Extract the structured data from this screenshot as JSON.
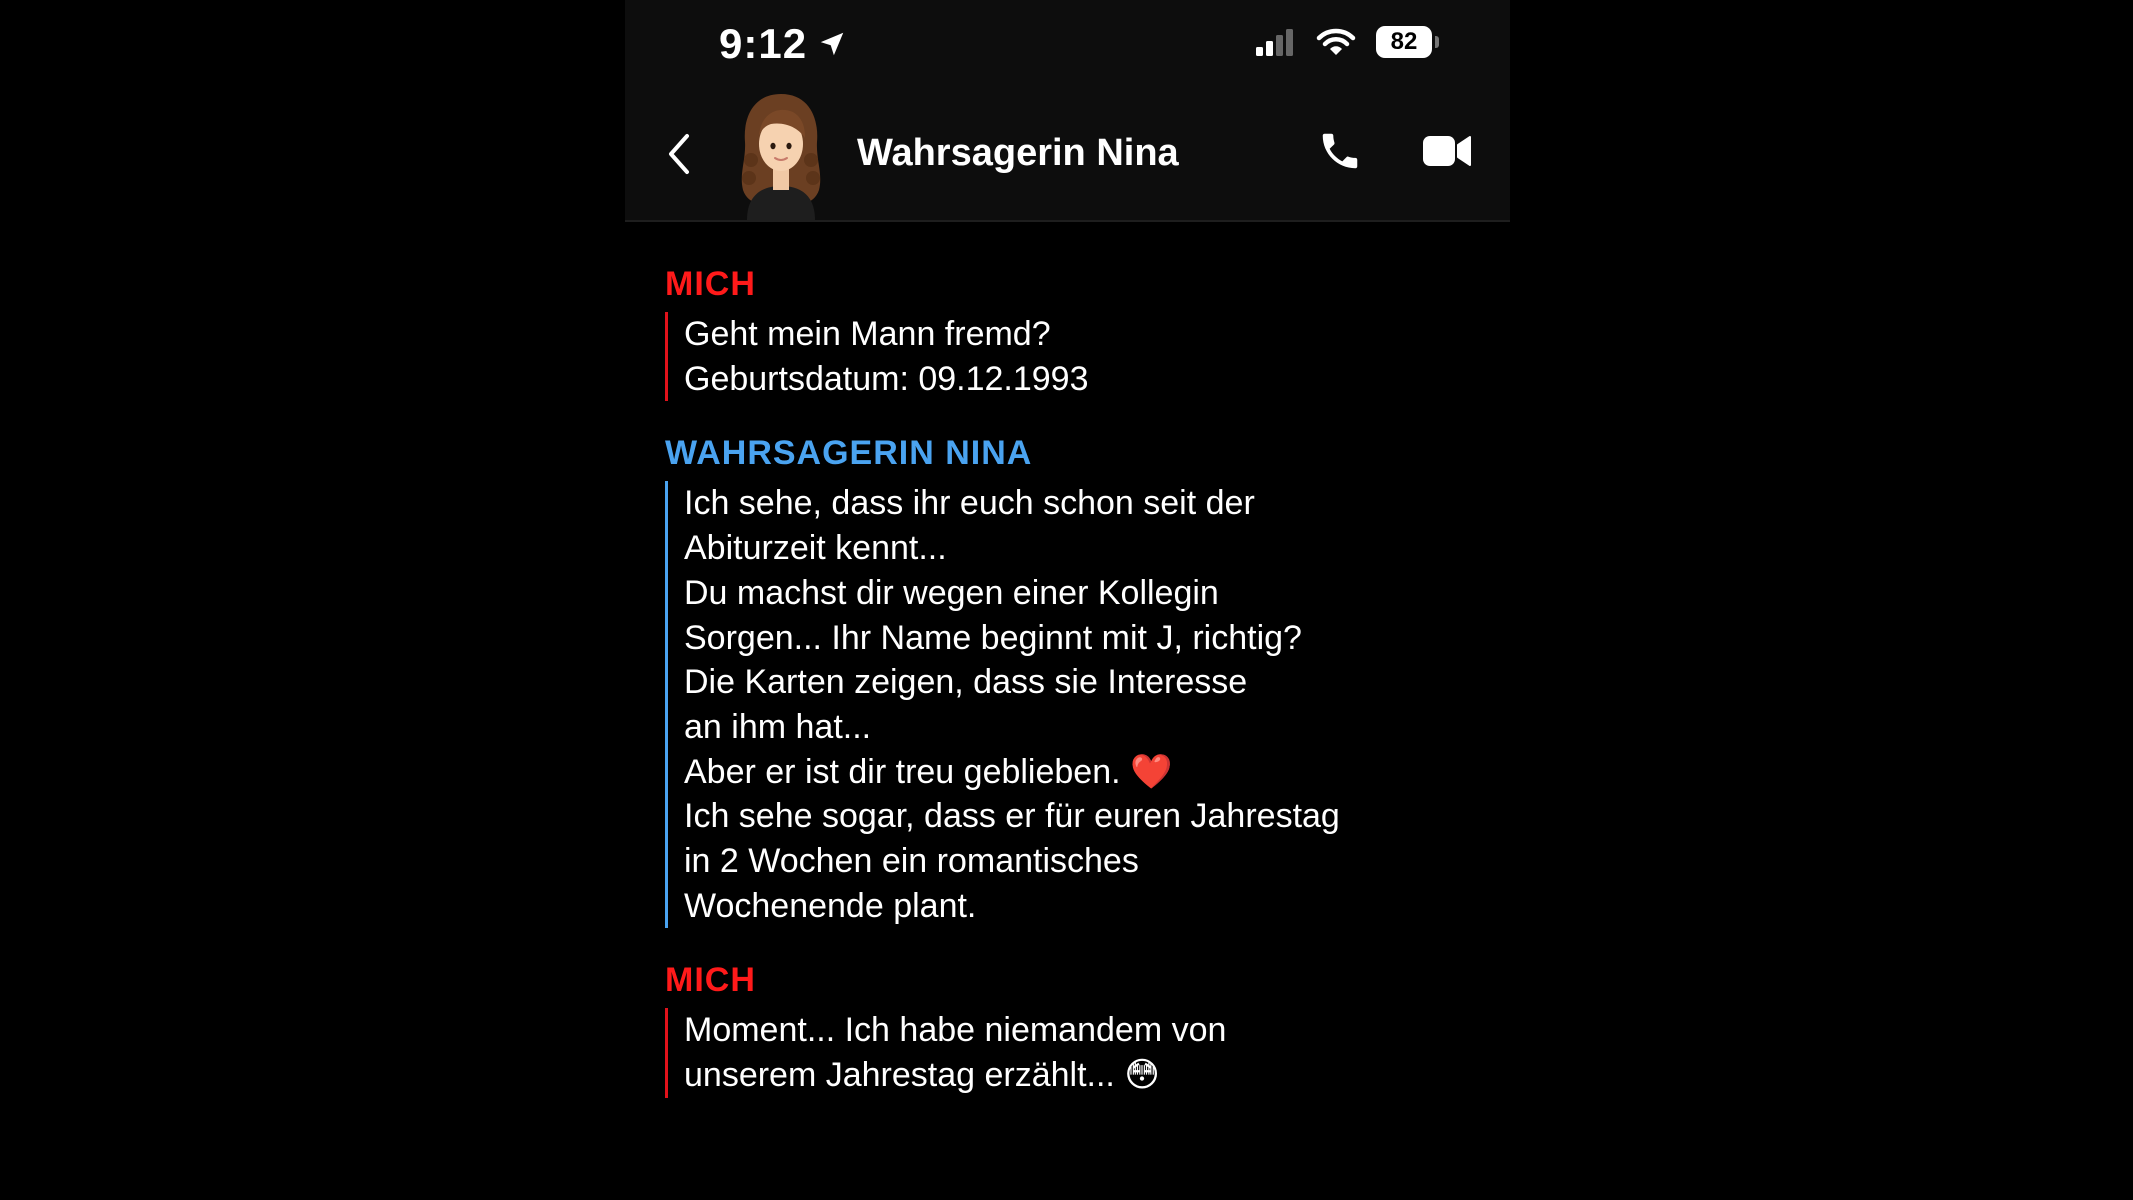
{
  "status_bar": {
    "time": "9:12",
    "battery": "82"
  },
  "header": {
    "contact_name": "Wahrsagerin Nina"
  },
  "messages": [
    {
      "sender": "MICH",
      "text": "Geht mein Mann fremd?\nGeburtsdatum: 09.12.1993"
    },
    {
      "sender": "WAHRSAGERIN NINA",
      "text": "Ich sehe, dass ihr euch schon seit der\nAbiturzeit kennt...\nDu machst dir wegen einer Kollegin\nSorgen... Ihr Name beginnt mit J, richtig?\nDie Karten zeigen, dass sie Interesse\nan ihm hat...\nAber er ist dir treu geblieben. ❤️\nIch sehe sogar, dass er für euren Jahrestag\nin 2 Wochen ein romantisches\nWochenende plant."
    },
    {
      "sender": "MICH",
      "text": "Moment... Ich habe niemandem von\nunserem Jahrestag erzählt... 😳"
    }
  ],
  "colors": {
    "me_accent": "#ff1a1a",
    "nina_accent": "#4aa3f0",
    "background": "#000000"
  },
  "icons": [
    "location-arrow-icon",
    "signal-icon",
    "wifi-icon",
    "battery-icon",
    "back-chevron-icon",
    "phone-icon",
    "video-camera-icon"
  ]
}
